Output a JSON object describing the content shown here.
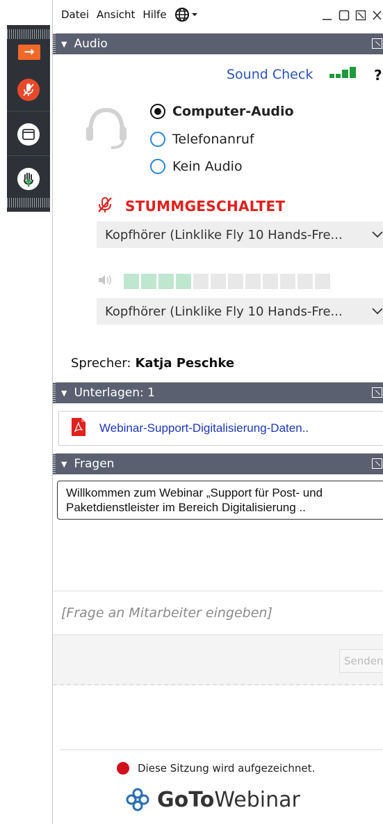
{
  "menu": {
    "items": [
      "Datei",
      "Ansicht",
      "Hilfe"
    ],
    "globe_icon": "globe-icon"
  },
  "toolbar": {
    "buttons": [
      "collapse-arrow-icon",
      "microphone-muted-icon",
      "window-icon",
      "raise-hand-icon"
    ],
    "colors": {
      "arrow": "#f0682a",
      "mic": "#e8492a",
      "hand": "#2ea44f"
    }
  },
  "audio": {
    "title": "Audio",
    "sound_check": "Sound Check",
    "help": "?",
    "options": [
      {
        "label": "Computer-Audio",
        "selected": true
      },
      {
        "label": "Telefonanruf",
        "selected": false
      },
      {
        "label": "Kein Audio",
        "selected": false
      }
    ],
    "muted_status": "STUMMGESCHALTET",
    "microphone_device": "Kopfhörer (Linklike Fly 10 Hands-Fre...",
    "speaker_device": "Kopfhörer (Linklike Fly 10 Hands-Fre...",
    "speaker_level": {
      "lit": 4,
      "total": 12
    },
    "speaker_label": "Sprecher:",
    "speaker_name": "Katja Peschke"
  },
  "handouts": {
    "title": "Unterlagen: 1",
    "file_name": "Webinar-Support-Digitalisierung-Daten.."
  },
  "questions": {
    "title": "Fragen",
    "welcome_message": "Willkommen zum Webinar „Support für Post- und Paketdienstleister im Bereich Digitalisierung ..",
    "input_placeholder": "[Frage an Mitarbeiter eingeben]",
    "send_label": "Senden"
  },
  "footer": {
    "recording_notice": "Diese Sitzung wird aufgezeichnet.",
    "brand_goto": "GoTo",
    "brand_webinar": "Webinar"
  }
}
